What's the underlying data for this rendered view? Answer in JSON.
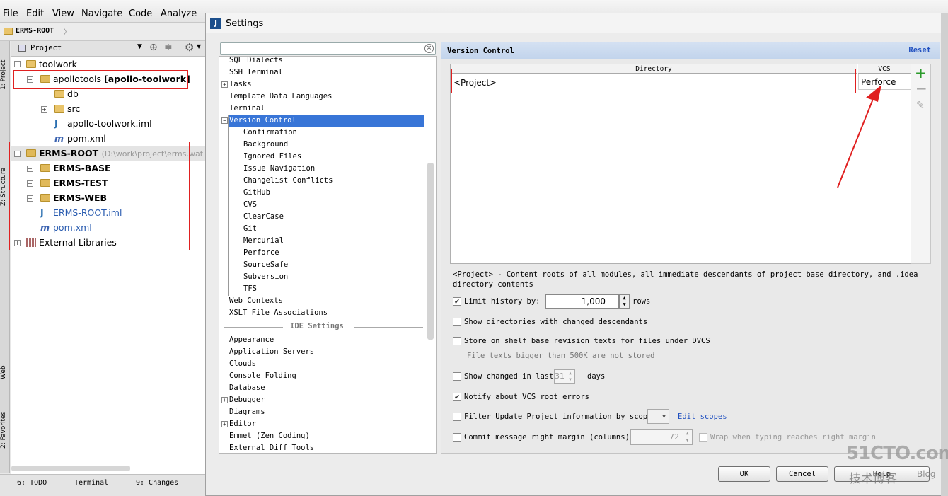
{
  "menubar": {
    "items": [
      "File",
      "Edit",
      "View",
      "Navigate",
      "Code",
      "Analyze"
    ]
  },
  "nav": {
    "breadcrumb": "ERMS-ROOT"
  },
  "side_tabs": {
    "project": "1: Project",
    "structure": "Z: Structure",
    "web": "Web",
    "favorites": "2: Favorites"
  },
  "project_panel": {
    "view_label": "Project",
    "tree": [
      {
        "label": "toolwork"
      },
      {
        "label": "apollotools",
        "bold_suffix": "[apollo-toolwork]"
      },
      {
        "label": "db"
      },
      {
        "label": "src"
      },
      {
        "label": "apollo-toolwork.iml"
      },
      {
        "label": "pom.xml"
      },
      {
        "label": "ERMS-ROOT",
        "suffix": "(D:\\work\\project\\erms.wat"
      },
      {
        "label": "ERMS-BASE"
      },
      {
        "label": "ERMS-TEST"
      },
      {
        "label": "ERMS-WEB"
      },
      {
        "label": "ERMS-ROOT.iml"
      },
      {
        "label": "pom.xml"
      },
      {
        "label": "External Libraries"
      }
    ]
  },
  "bottom_tabs": {
    "todo": "6: TODO",
    "terminal": "Terminal",
    "changes": "9: Changes"
  },
  "dialog": {
    "title": "Settings",
    "search_placeholder": "",
    "settings_tree": {
      "top_items": [
        "SQL Dialects",
        "SSH Terminal",
        "Tasks",
        "Template Data Languages",
        "Terminal"
      ],
      "selected": "Version Control",
      "vc_children": [
        "Confirmation",
        "Background",
        "Ignored Files",
        "Issue Navigation",
        "Changelist Conflicts",
        "GitHub",
        "CVS",
        "ClearCase",
        "Git",
        "Mercurial",
        "Perforce",
        "SourceSafe",
        "Subversion",
        "TFS"
      ],
      "after_items": [
        "Web Contexts",
        "XSLT File Associations"
      ],
      "ide_header": "IDE Settings",
      "ide_items": [
        "Appearance",
        "Application Servers",
        "Clouds",
        "Console Folding",
        "Database",
        "Debugger",
        "Diagrams",
        "Editor",
        "Emmet (Zen Coding)",
        "External Diff Tools"
      ]
    },
    "panel": {
      "title": "Version Control",
      "reset": "Reset",
      "table": {
        "col_directory": "Directory",
        "col_vcs": "VCS",
        "row_directory": "<Project>",
        "row_vcs": "Perforce"
      },
      "note_line1": "<Project> - Content roots of all modules, all immediate descendants of project base directory, and .idea",
      "note_line2": "directory contents",
      "limit_history": {
        "label": "Limit history by:",
        "value": "1,000",
        "unit": "rows",
        "checked": true
      },
      "show_dirs": {
        "label": "Show directories with changed descendants",
        "checked": false
      },
      "store_shelf": {
        "label": "Store on shelf base revision texts for files under DVCS",
        "checked": false,
        "note": "File texts bigger than 500K are not stored"
      },
      "show_changed": {
        "label": "Show changed in last",
        "value": "31",
        "unit": "days",
        "checked": false
      },
      "notify": {
        "label": "Notify about VCS root errors",
        "checked": true
      },
      "filter_update": {
        "label": "Filter Update Project information by scope",
        "link": "Edit scopes",
        "checked": false
      },
      "commit_margin": {
        "label": "Commit message right margin (columns):",
        "value": "72",
        "wrap_label": "Wrap when typing reaches right margin",
        "checked": false
      }
    },
    "buttons": {
      "ok": "OK",
      "cancel": "Cancel",
      "help": "Help"
    }
  },
  "watermark": {
    "line1": "51CTO.com",
    "line2": "技术博客",
    "line3": "Blog"
  }
}
